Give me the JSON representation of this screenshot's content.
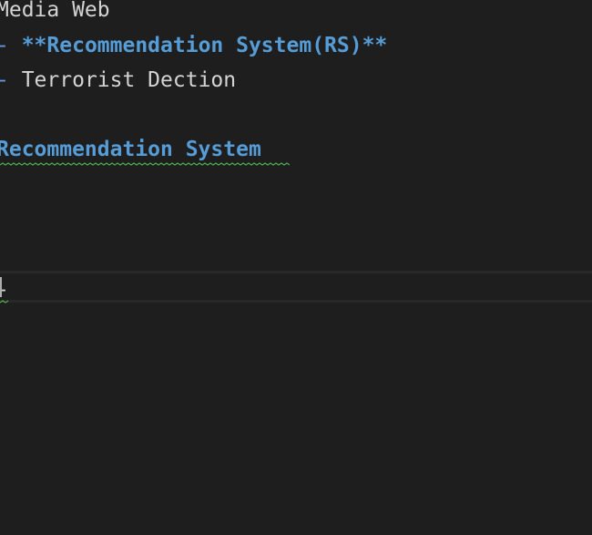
{
  "editor": {
    "lines": {
      "media_web": "Media Web",
      "rs_dash": "- ",
      "rs_text": "**Recommendation System(RS)**",
      "td_dash": "- ",
      "td_text": "Terrorist Dection",
      "heading": "Recommendation System",
      "current_dash": "-"
    }
  },
  "colors": {
    "background": "#1e1e1e",
    "text": "#d4d4d4",
    "markdown_blue": "#569cd6",
    "list_marker": "#6796e6",
    "squiggle_green": "#4caf50"
  }
}
